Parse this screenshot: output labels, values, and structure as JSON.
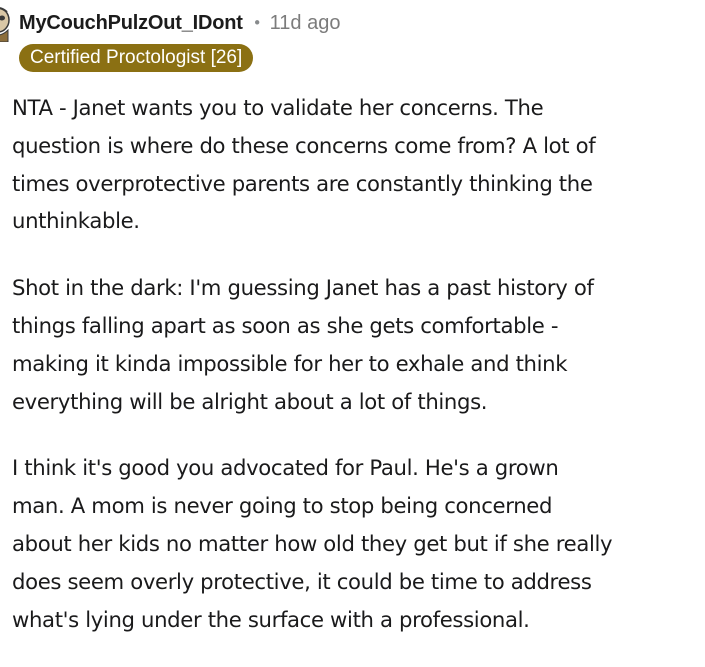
{
  "comment": {
    "author": "MyCouchPulzOut_IDont",
    "separator": "•",
    "timestamp": "11d ago",
    "flair": "Certified Proctologist [26]",
    "paragraphs": [
      {
        "lines": [
          "NTA - Janet wants you to validate her concerns. The",
          "question is where do these concerns come from? A lot of",
          "times overprotective parents are constantly thinking the",
          "unthinkable."
        ]
      },
      {
        "lines": [
          "Shot in the dark: I'm guessing Janet has a past history of",
          "things falling apart as soon as she gets comfortable -",
          "making it kinda impossible for her to exhale and think",
          "everything will be alright about a lot of things."
        ]
      },
      {
        "lines": [
          "I think it's good you advocated for Paul. He's a grown",
          "man. A mom is never going to stop being concerned",
          "about her kids no matter how old they get but if she really",
          "does seem overly protective, it could be time to address",
          "what's lying under the surface with a professional."
        ]
      }
    ]
  },
  "colors": {
    "flair_background": "#8b7013",
    "flair_text": "#ffffff",
    "author": "#1c1c1c",
    "timestamp": "#7c7c7c",
    "body_text": "#1a1a1b"
  },
  "icons": {
    "avatar": "user-avatar-icon"
  }
}
